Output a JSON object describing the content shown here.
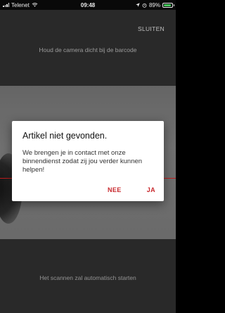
{
  "status_bar": {
    "carrier": "Telenet",
    "time": "09:48",
    "battery_percent": "89%",
    "battery_level": 0.89
  },
  "scanner": {
    "close_label": "SLUITEN",
    "hint_top": "Houd de camera dicht bij de barcode",
    "hint_bottom": "Het scannen zal automatisch starten",
    "scan_line_color": "#d02020"
  },
  "dialog": {
    "title": "Artikel niet gevonden.",
    "message": "We brengen je in contact met onze binnendienst zodat zij jou verder kunnen helpen!",
    "no_label": "NEE",
    "yes_label": "JA",
    "accent_color": "#c8282d"
  }
}
